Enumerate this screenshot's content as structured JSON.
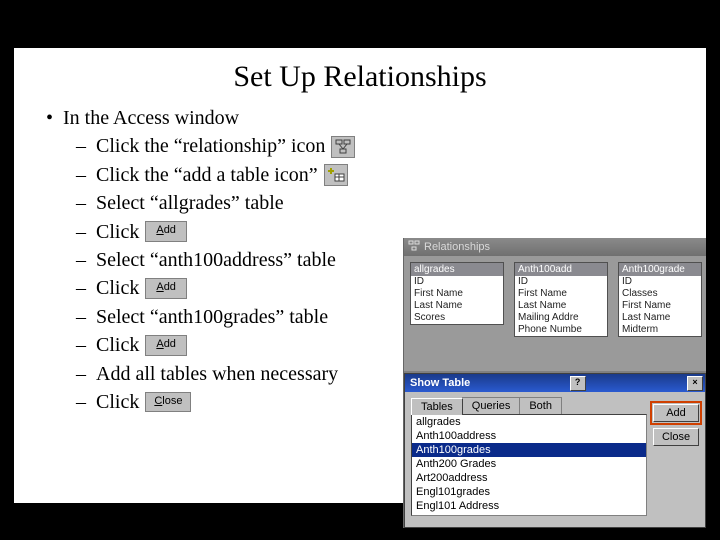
{
  "title": "Set Up Relationships",
  "l1": "In the Access window",
  "steps": {
    "s0": "Click the “relationship” icon",
    "s1": " Click the “add a table icon”",
    "s2": "Select “allgrades” table",
    "s3": "Click",
    "s4": "Select “anth100address” table",
    "s5": "Click",
    "s6": "Select “anth100grades” table",
    "s7": "Click",
    "s8": "Add all tables when necessary",
    "s9": "Click"
  },
  "btn_add": "Add",
  "btn_close": "Close",
  "rel_window_title": "Relationships",
  "tables": {
    "t1": {
      "name": "allgrades",
      "rows": [
        "ID",
        "First Name",
        "Last Name",
        "Scores"
      ]
    },
    "t2": {
      "name": "Anth100add",
      "rows": [
        "ID",
        "First Name",
        "Last Name",
        "Mailing Addre",
        "Phone Numbe"
      ]
    },
    "t3": {
      "name": "Anth100grade",
      "rows": [
        "ID",
        "Classes",
        "First Name",
        "Last Name",
        "Midterm"
      ]
    }
  },
  "show_table": {
    "title": "Show Table",
    "tabs": {
      "t1": "Tables",
      "t2": "Queries",
      "t3": "Both"
    },
    "items": {
      "i0": "allgrades",
      "i1": "Anth100address",
      "i2": "Anth100grades",
      "i3": "Anth200 Grades",
      "i4": "Art200address",
      "i5": "Engl101grades",
      "i6": "Engl101 Address"
    },
    "add": "Add",
    "close": "Close"
  }
}
